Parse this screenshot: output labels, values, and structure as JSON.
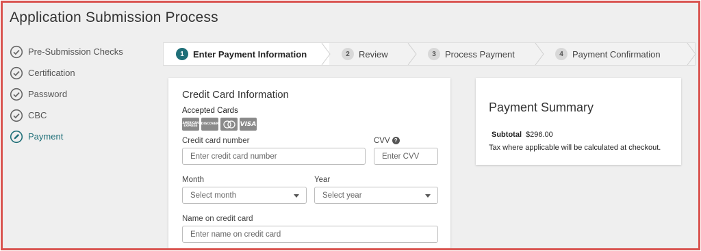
{
  "page_title": "Application Submission Process",
  "sidebar": {
    "items": [
      {
        "label": "Pre-Submission Checks",
        "icon": "check-circle-icon",
        "state": "done"
      },
      {
        "label": "Certification",
        "icon": "check-circle-icon",
        "state": "done"
      },
      {
        "label": "Password",
        "icon": "check-circle-icon",
        "state": "done"
      },
      {
        "label": "CBC",
        "icon": "check-circle-icon",
        "state": "done"
      },
      {
        "label": "Payment",
        "icon": "pencil-circle-icon",
        "state": "active"
      }
    ]
  },
  "stepper": {
    "steps": [
      {
        "number": "1",
        "label": "Enter Payment Information",
        "active": true
      },
      {
        "number": "2",
        "label": "Review",
        "active": false
      },
      {
        "number": "3",
        "label": "Process Payment",
        "active": false
      },
      {
        "number": "4",
        "label": "Payment Confirmation",
        "active": false
      }
    ]
  },
  "credit_card": {
    "title": "Credit Card Information",
    "accepted_label": "Accepted Cards",
    "logos": [
      "AMERICAN EXPRESS",
      "DISCOVER",
      "mastercard",
      "VISA"
    ],
    "number_label": "Credit card number",
    "number_placeholder": "Enter credit card number",
    "cvv_label": "CVV",
    "cvv_help": "?",
    "cvv_placeholder": "Enter CVV",
    "month_label": "Month",
    "month_placeholder": "Select month",
    "year_label": "Year",
    "year_placeholder": "Select year",
    "name_label": "Name on credit card",
    "name_placeholder": "Enter name on credit card"
  },
  "summary": {
    "title": "Payment Summary",
    "subtotal_label": "Subtotal",
    "subtotal_value": "$296.00",
    "tax_note": "Tax where applicable will be calculated at checkout."
  },
  "colors": {
    "accent": "#1f6f78",
    "frame_border": "#d9534f",
    "background": "#efefef"
  }
}
